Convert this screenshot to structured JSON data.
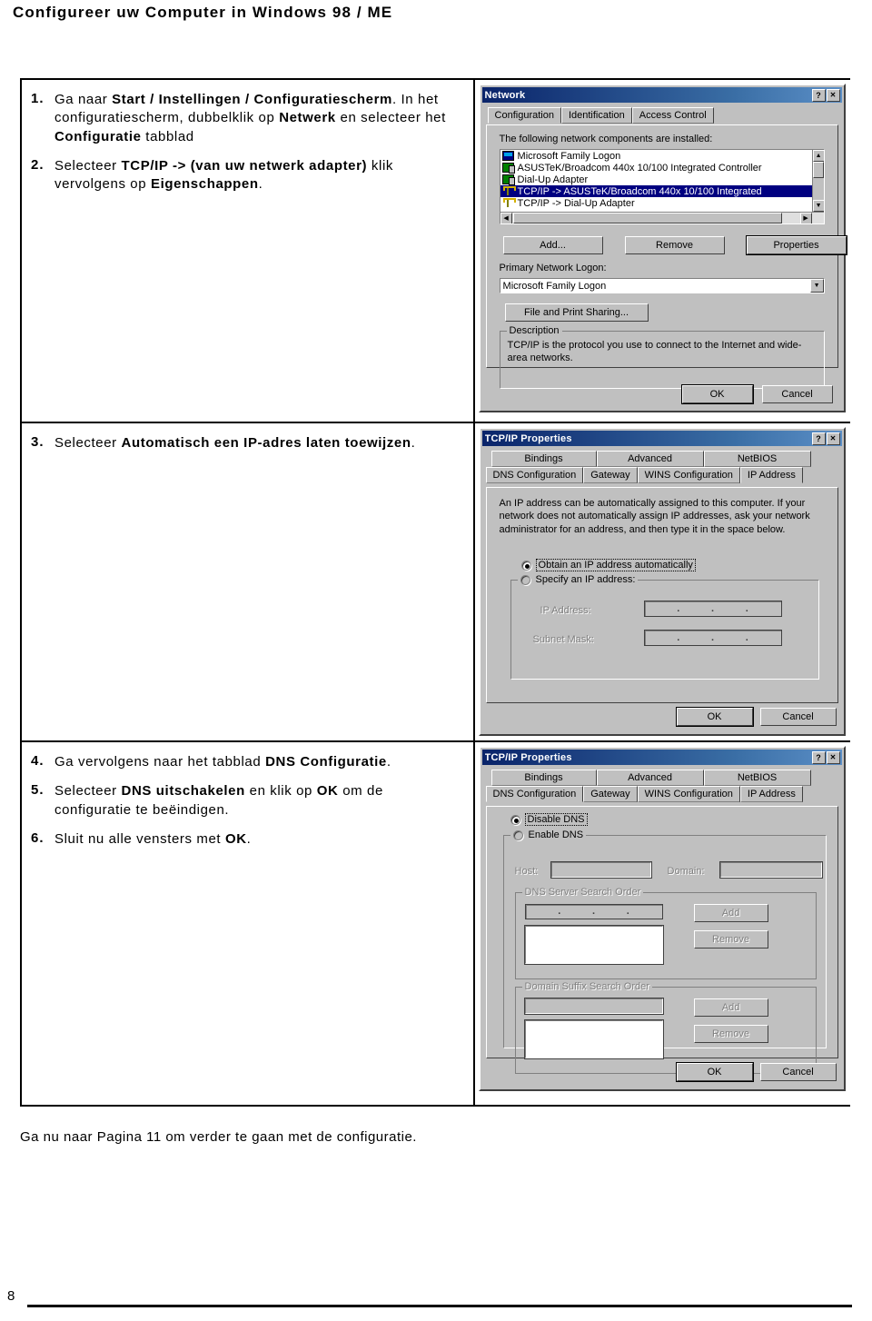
{
  "document": {
    "title": "Configureer uw Computer in Windows 98 / ME",
    "footer_note": "Ga nu naar Pagina 11 om verder te gaan met de configuratie.",
    "page_number": "8"
  },
  "steps": [
    {
      "num": "1.",
      "parts": [
        {
          "t": "Ga naar ",
          "b": false
        },
        {
          "t": "Start / Instellingen / Configuratiescherm",
          "b": true
        },
        {
          "t": ". In het configuratiescherm, dubbelklik op ",
          "b": false
        },
        {
          "t": "Netwerk",
          "b": true
        },
        {
          "t": " en selecteer het ",
          "b": false
        },
        {
          "t": "Configuratie",
          "b": true
        },
        {
          "t": " tabblad",
          "b": false
        }
      ]
    },
    {
      "num": "2.",
      "parts": [
        {
          "t": "Selecteer ",
          "b": false
        },
        {
          "t": "TCP/IP -> (van uw netwerk adapter)",
          "b": true
        },
        {
          "t": " klik vervolgens op ",
          "b": false
        },
        {
          "t": "Eigenschappen",
          "b": true
        },
        {
          "t": ".",
          "b": false
        }
      ]
    },
    {
      "num": "3.",
      "parts": [
        {
          "t": "Selecteer ",
          "b": false
        },
        {
          "t": "Automatisch een IP-adres laten toewijzen",
          "b": true
        },
        {
          "t": ".",
          "b": false
        }
      ]
    },
    {
      "num": "4.",
      "parts": [
        {
          "t": "Ga vervolgens naar het tabblad ",
          "b": false
        },
        {
          "t": "DNS Configuratie",
          "b": true
        },
        {
          "t": ".",
          "b": false
        }
      ]
    },
    {
      "num": "5.",
      "parts": [
        {
          "t": "Selecteer ",
          "b": false
        },
        {
          "t": "DNS uitschakelen",
          "b": true
        },
        {
          "t": " en klik op ",
          "b": false
        },
        {
          "t": "OK",
          "b": true
        },
        {
          "t": " om de configuratie te beëindigen.",
          "b": false
        }
      ]
    },
    {
      "num": "6.",
      "parts": [
        {
          "t": "Sluit nu alle vensters met ",
          "b": false
        },
        {
          "t": "OK",
          "b": true
        },
        {
          "t": ".",
          "b": false
        }
      ]
    }
  ],
  "network_dialog": {
    "title": "Network",
    "help_button": "?",
    "close_button": "✕",
    "tabs": [
      {
        "label": "Configuration",
        "active": true
      },
      {
        "label": "Identification",
        "active": false
      },
      {
        "label": "Access Control",
        "active": false
      }
    ],
    "list_caption": "The following network components are installed:",
    "components": [
      {
        "label": "Microsoft Family Logon",
        "icon": "computer-icon",
        "selected": false
      },
      {
        "label": "ASUSTeK/Broadcom 440x 10/100 Integrated Controller",
        "icon": "network-adapter-icon",
        "selected": false
      },
      {
        "label": "Dial-Up Adapter",
        "icon": "network-adapter-icon",
        "selected": false
      },
      {
        "label": "TCP/IP -> ASUSTeK/Broadcom 440x 10/100 Integrated",
        "icon": "protocol-icon",
        "selected": true
      },
      {
        "label": "TCP/IP -> Dial-Up Adapter",
        "icon": "protocol-icon",
        "selected": false
      }
    ],
    "buttons": {
      "add": "Add...",
      "remove": "Remove",
      "properties": "Properties",
      "file_print_sharing": "File and Print Sharing...",
      "ok": "OK",
      "cancel": "Cancel"
    },
    "primary_logon_label": "Primary Network Logon:",
    "primary_logon_value": "Microsoft Family Logon",
    "description_group": "Description",
    "description_text": "TCP/IP is the protocol you use to connect to the Internet and wide-area networks."
  },
  "tcpip_ip_dialog": {
    "title": "TCP/IP Properties",
    "help_button": "?",
    "close_button": "✕",
    "tabs_row1": [
      {
        "label": "Bindings",
        "active": false
      },
      {
        "label": "Advanced",
        "active": false
      },
      {
        "label": "NetBIOS",
        "active": false
      }
    ],
    "tabs_row2": [
      {
        "label": "DNS Configuration",
        "active": false
      },
      {
        "label": "Gateway",
        "active": false
      },
      {
        "label": "WINS Configuration",
        "active": false
      },
      {
        "label": "IP Address",
        "active": true
      }
    ],
    "description": "An IP address can be automatically assigned to this computer. If your network does not automatically assign IP addresses, ask your network administrator for an address, and then type it in the space below.",
    "radio_auto": "Obtain an IP address automatically",
    "radio_auto_selected": true,
    "radio_specify": "Specify an IP address:",
    "radio_specify_selected": false,
    "ip_address_label": "IP Address:",
    "ip_address_value": "",
    "subnet_mask_label": "Subnet Mask:",
    "subnet_mask_value": "",
    "buttons": {
      "ok": "OK",
      "cancel": "Cancel"
    }
  },
  "tcpip_dns_dialog": {
    "title": "TCP/IP Properties",
    "help_button": "?",
    "close_button": "✕",
    "tabs_row1": [
      {
        "label": "Bindings",
        "active": false
      },
      {
        "label": "Advanced",
        "active": false
      },
      {
        "label": "NetBIOS",
        "active": false
      }
    ],
    "tabs_row2": [
      {
        "label": "DNS Configuration",
        "active": true
      },
      {
        "label": "Gateway",
        "active": false
      },
      {
        "label": "WINS Configuration",
        "active": false
      },
      {
        "label": "IP Address",
        "active": false
      }
    ],
    "radio_disable": "Disable DNS",
    "radio_disable_selected": true,
    "radio_enable": "Enable DNS",
    "radio_enable_selected": false,
    "host_label": "Host:",
    "host_value": "",
    "domain_label": "Domain:",
    "domain_value": "",
    "dns_group": "DNS Server Search Order",
    "dns_add": "Add",
    "dns_remove": "Remove",
    "suffix_group": "Domain Suffix Search Order",
    "suffix_add": "Add",
    "suffix_remove": "Remove",
    "buttons": {
      "ok": "OK",
      "cancel": "Cancel"
    }
  },
  "colors": {
    "titlebar_start": "#0a246a",
    "titlebar_end": "#5b8fc7",
    "dialog_face": "#c0c0c0",
    "selection": "#000080"
  }
}
